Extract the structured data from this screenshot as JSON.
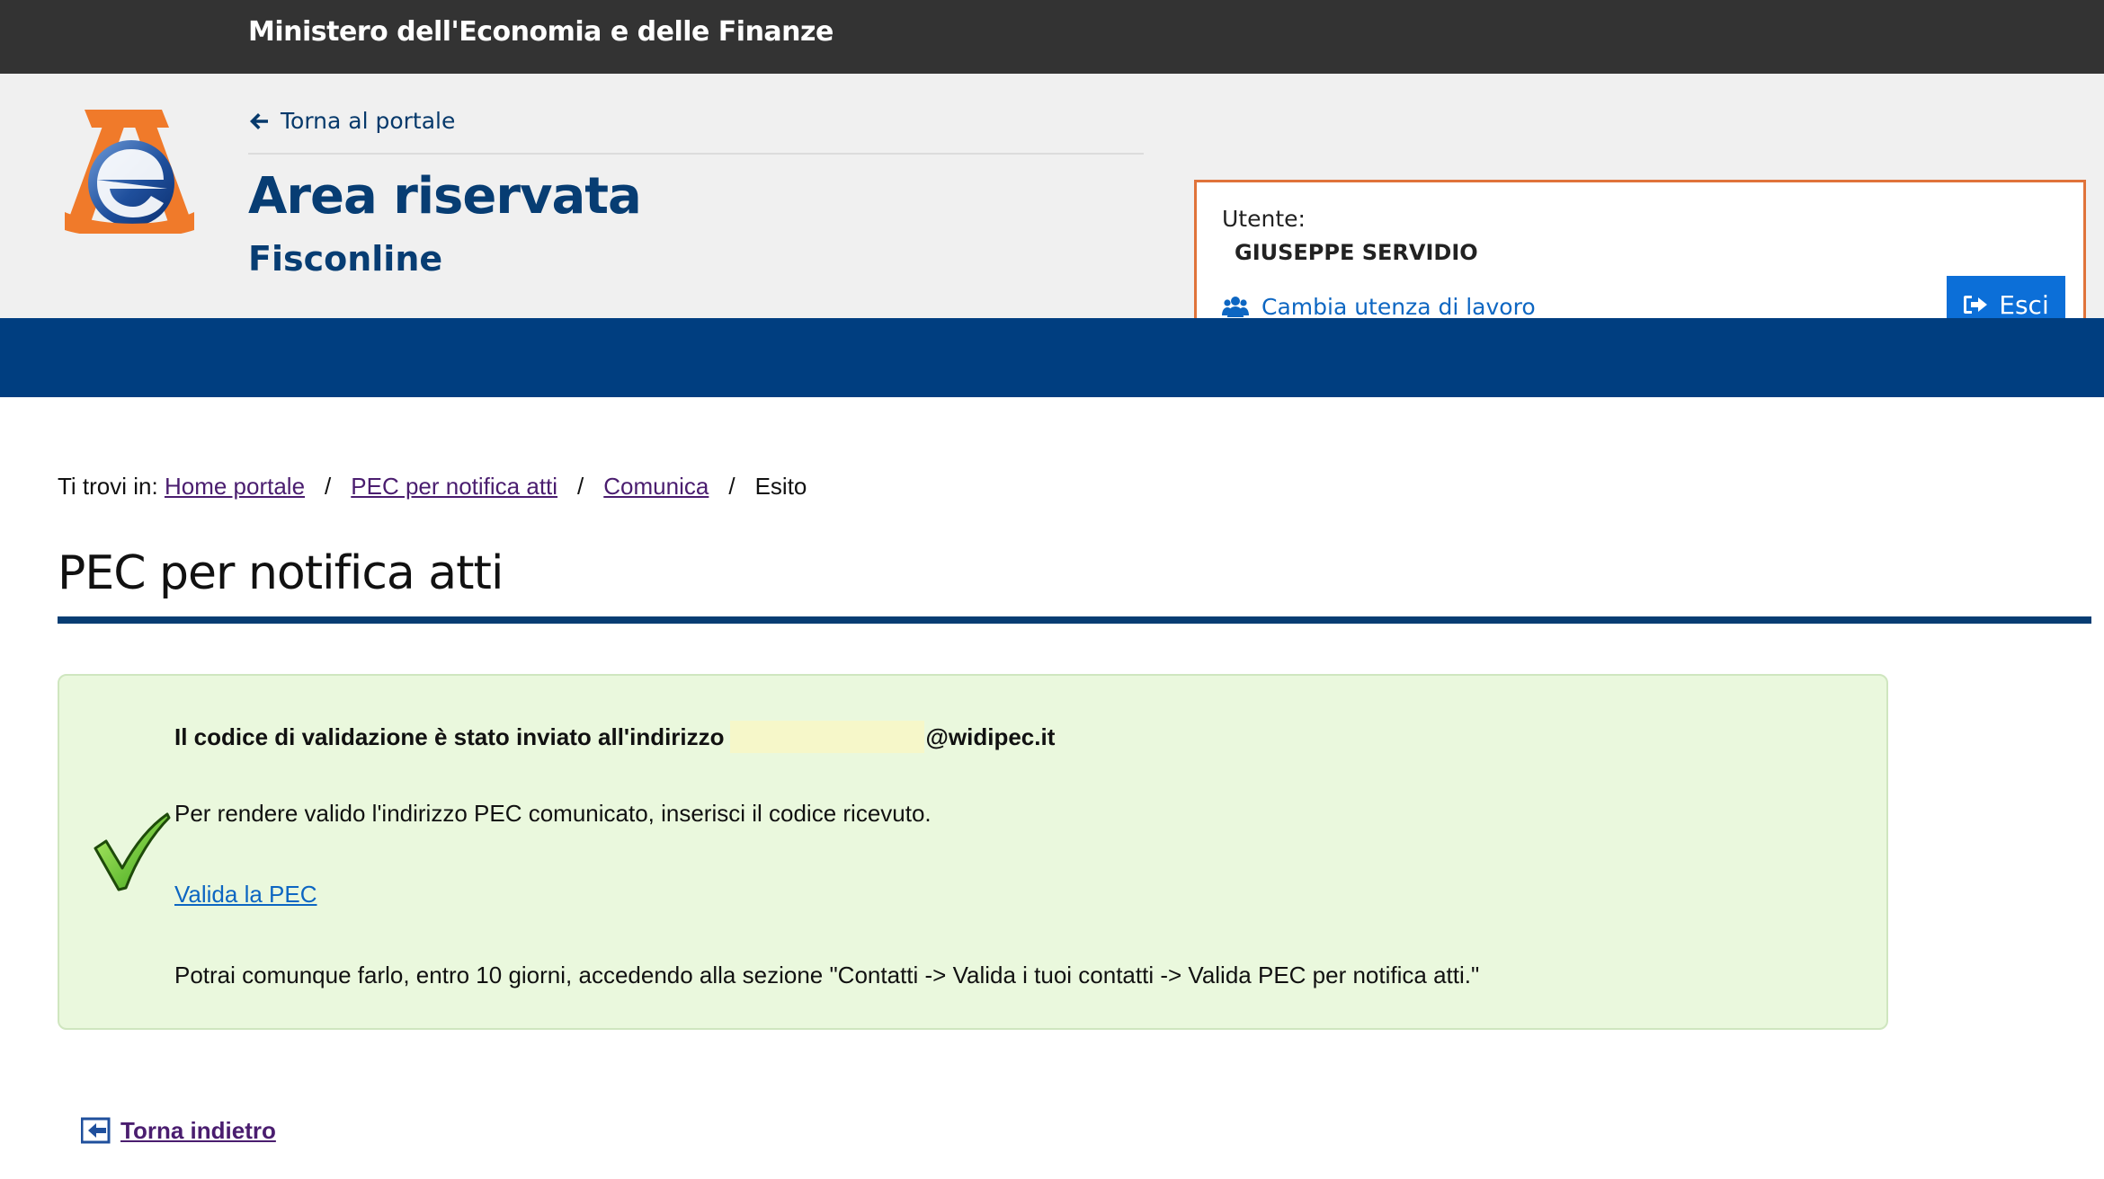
{
  "topbar": {
    "ministry": "Ministero dell'Economia e delle Finanze"
  },
  "header": {
    "back_link": "Torna al portale",
    "title": "Area riservata",
    "subtitle": "Fisconline"
  },
  "user": {
    "label": "Utente:",
    "name": "GIUSEPPE SERVIDIO",
    "switch_label": "Cambia utenza di lavoro",
    "logout_label": "Esci"
  },
  "breadcrumb": {
    "prefix": "Ti trovi in:",
    "items": [
      "Home portale",
      "PEC per notifica atti",
      "Comunica"
    ],
    "separator": "/",
    "current": "Esito"
  },
  "page_title": "PEC per notifica atti",
  "notice": {
    "line1_prefix": "Il codice di validazione è stato inviato all'indirizzo",
    "line1_domain": "@widipec.it",
    "line2": "Per rendere valido l'indirizzo PEC comunicato, inserisci il codice ricevuto.",
    "link": "Valida la PEC",
    "line3": "Potrai comunque farlo, entro 10 giorni, accedendo alla sezione \"Contatti -> Valida i tuoi contatti -> Valida PEC per notifica atti.\""
  },
  "back_button": "Torna indietro",
  "colors": {
    "topbar": "#333333",
    "brand_blue": "#003e80",
    "title_blue": "#073d73",
    "accent_orange": "#e0733a",
    "button_blue": "#0c6fd8",
    "success_bg": "#eaf8dd"
  }
}
